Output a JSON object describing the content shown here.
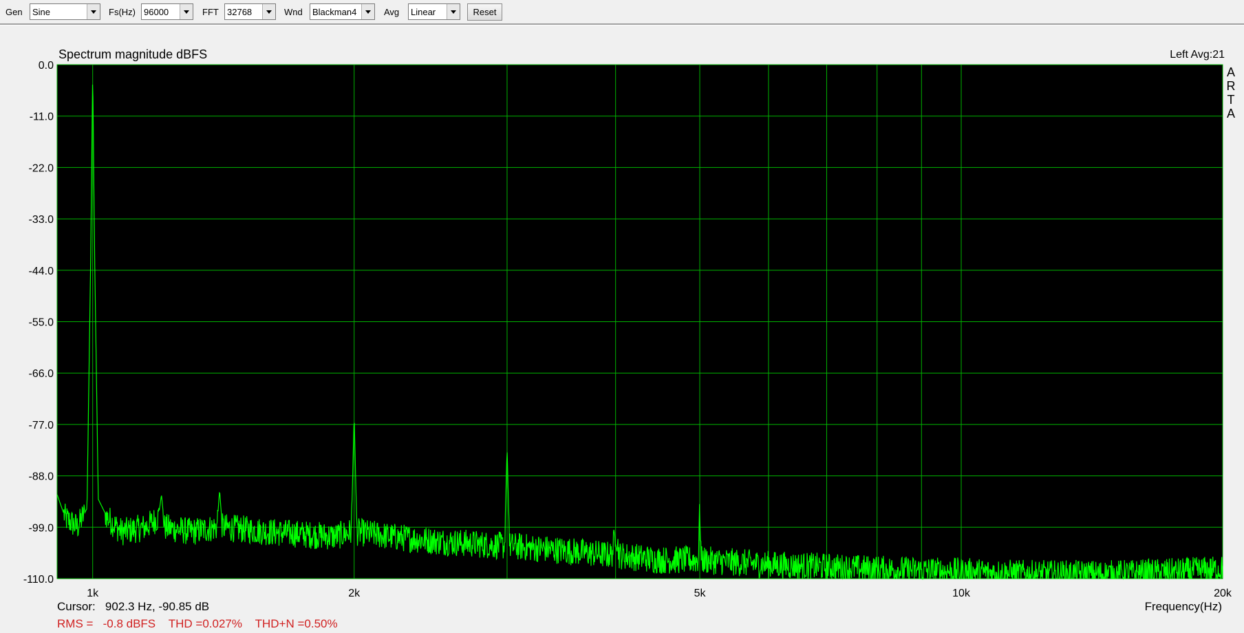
{
  "toolbar": {
    "gen_label": "Gen",
    "gen_value": "Sine",
    "fs_label": "Fs(Hz)",
    "fs_value": "96000",
    "fft_label": "FFT",
    "fft_value": "32768",
    "wnd_label": "Wnd",
    "wnd_value": "Blackman4",
    "avg_label": "Avg",
    "avg_value": "Linear",
    "reset_label": "Reset"
  },
  "plot": {
    "title": "Spectrum magnitude dBFS",
    "channel_info": "Left  Avg:21",
    "watermark": [
      "A",
      "R",
      "T",
      "A"
    ],
    "xlabel": "Frequency(Hz)",
    "cursor_prefix": "Cursor:",
    "cursor_text": "902.3 Hz, -90.85 dB",
    "stats": {
      "rms_label": "RMS =",
      "rms_value": "-0.8 dBFS",
      "thd": "THD =0.027%",
      "thdn": "THD+N =0.50%"
    }
  },
  "colors": {
    "background": "#000000",
    "grid": "#00b400",
    "trace": "#00ff00",
    "stats": "#d02020"
  },
  "chart_data": {
    "type": "line",
    "title": "Spectrum magnitude dBFS",
    "xlabel": "Frequency(Hz)",
    "ylabel": "",
    "xscale": "log",
    "xlim": [
      910,
      20000
    ],
    "ylim": [
      -110,
      0
    ],
    "grid": true,
    "y_ticks": [
      0,
      -11,
      -22,
      -33,
      -44,
      -55,
      -66,
      -77,
      -88,
      -99,
      -110
    ],
    "y_tick_labels": [
      "0.0",
      "-11.0",
      "-22.0",
      "-33.0",
      "-44.0",
      "-55.0",
      "-66.0",
      "-77.0",
      "-88.0",
      "-99.0",
      "-110.0"
    ],
    "x_ticks": [
      1000,
      2000,
      5000,
      10000,
      20000
    ],
    "x_tick_labels": [
      "1k",
      "2k",
      "5k",
      "10k",
      "20k"
    ],
    "series": [
      {
        "x": [
          910,
          930,
          960,
          985,
          995,
          1000,
          1005,
          1015,
          1040,
          1080,
          1150,
          1190,
          1200,
          1210,
          1300,
          1390,
          1400,
          1410,
          1600,
          1900,
          1985,
          2000,
          2015,
          2200,
          2500,
          2980,
          3000,
          3020,
          3500,
          3960,
          4000,
          4040,
          4500,
          4980,
          5000,
          5020,
          6000,
          7000,
          8000,
          10000,
          12000,
          15000,
          18000,
          20000
        ],
        "y": [
          -92,
          -97,
          -99,
          -95,
          -40,
          -1,
          -40,
          -93,
          -97,
          -100,
          -99,
          -97,
          -92,
          -99,
          -100,
          -99,
          -91,
          -99,
          -100,
          -101,
          -100,
          -75,
          -100,
          -101,
          -102,
          -103,
          -82,
          -103,
          -104,
          -105,
          -100,
          -105,
          -106,
          -106,
          -95,
          -106,
          -107,
          -107.5,
          -108,
          -108.5,
          -109,
          -109,
          -108.5,
          -108
        ]
      }
    ]
  }
}
